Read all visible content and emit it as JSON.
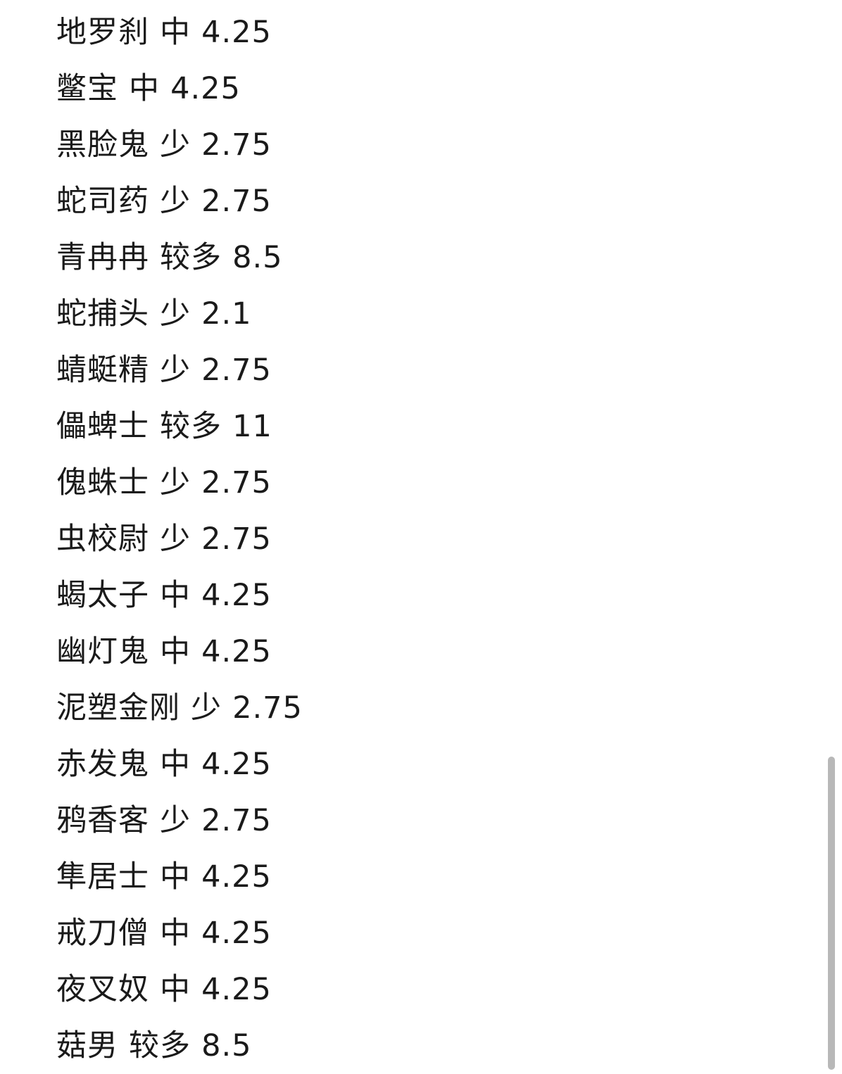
{
  "items": [
    {
      "name": "地罗刹",
      "level": "中",
      "value": "4.25"
    },
    {
      "name": "鳖宝",
      "level": "中",
      "value": "4.25"
    },
    {
      "name": "黑脸鬼",
      "level": "少",
      "value": "2.75"
    },
    {
      "name": "蛇司药",
      "level": "少",
      "value": "2.75"
    },
    {
      "name": "青冉冉",
      "level": "较多",
      "value": "8.5"
    },
    {
      "name": "蛇捕头",
      "level": "少",
      "value": "2.1"
    },
    {
      "name": "蜻蜓精",
      "level": "少",
      "value": "2.75"
    },
    {
      "name": "儡蜱士",
      "level": "较多",
      "value": "11"
    },
    {
      "name": "傀蛛士",
      "level": "少",
      "value": "2.75"
    },
    {
      "name": "虫校尉",
      "level": "少",
      "value": "2.75"
    },
    {
      "name": "蝎太子",
      "level": "中",
      "value": "4.25"
    },
    {
      "name": "幽灯鬼",
      "level": "中",
      "value": "4.25"
    },
    {
      "name": "泥塑金刚",
      "level": "少",
      "value": "2.75"
    },
    {
      "name": "赤发鬼",
      "level": "中",
      "value": "4.25"
    },
    {
      "name": "鸦香客",
      "level": "少",
      "value": "2.75"
    },
    {
      "name": "隼居士",
      "level": "中",
      "value": "4.25"
    },
    {
      "name": "戒刀僧",
      "level": "中",
      "value": "4.25"
    },
    {
      "name": "夜叉奴",
      "level": "中",
      "value": "4.25"
    },
    {
      "name": "菇男",
      "level": "较多",
      "value": "8.5"
    }
  ]
}
